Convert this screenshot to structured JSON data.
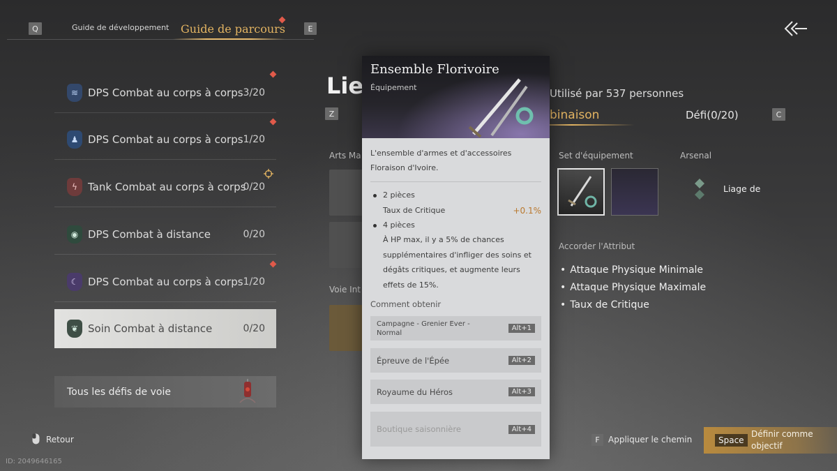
{
  "top_nav": {
    "key_left": "Q",
    "tab_dev": "Guide de développement",
    "tab_parcours": "Guide de parcours",
    "key_right": "E"
  },
  "paths": [
    {
      "name": "DPS Combat au corps à corps",
      "count": "3/20",
      "icon": "wave-icon",
      "alert": true
    },
    {
      "name": "DPS Combat au corps à corps",
      "count": "1/20",
      "icon": "figure-icon",
      "alert": true
    },
    {
      "name": "Tank Combat au corps à corps",
      "count": "0/20",
      "icon": "lightning-icon",
      "alert": false,
      "target": true
    },
    {
      "name": "DPS Combat à distance",
      "count": "0/20",
      "icon": "eye-icon",
      "alert": false
    },
    {
      "name": "DPS Combat au corps à corps",
      "count": "1/20",
      "icon": "crescent-icon",
      "alert": true
    },
    {
      "name": "Soin Combat à distance",
      "count": "0/20",
      "icon": "leaf-icon",
      "alert": false,
      "selected": true
    }
  ],
  "all_challenges": "Tous les défis de voie",
  "main": {
    "title": "Lien",
    "used_by": "Utilisé par 537 personnes",
    "key_z": "Z",
    "tab_combinaison": "binaison",
    "tab_defi": "Défi(0/20)",
    "key_c": "C",
    "arts_label": "Arts Ma",
    "voie_label": "Voie Int",
    "set_label": "Set d'équipement",
    "arsenal_label": "Arsenal",
    "arsenal_item": "Liage de",
    "attr_label": "Accorder l'Attribut",
    "attributes": [
      "Attaque Physique Minimale",
      "Attaque Physique Maximale",
      "Taux de Critique"
    ]
  },
  "popup": {
    "title": "Ensemble Florivoire",
    "subtitle": "Équipement",
    "description": "L'ensemble d'armes et d'accessoires Floraison d'Ivoire.",
    "bonus2_title": "2 pièces",
    "bonus2_stat": "Taux de Critique",
    "bonus2_value": "+0.1%",
    "bonus4_title": "4 pièces",
    "bonus4_text": "À HP max, il y a 5% de chances supplémentaires d'infliger des soins et dégâts critiques, et augmente leurs effets de 15%.",
    "obtain_label": "Comment obtenir",
    "sources": [
      {
        "name": "Campagne - Grenier Ever -Normal",
        "key": "Alt+1"
      },
      {
        "name": "Épreuve de l'Épée",
        "key": "Alt+2"
      },
      {
        "name": "Royaume du Héros",
        "key": "Alt+3"
      },
      {
        "name": "Boutique saisonnière",
        "key": "Alt+4"
      }
    ]
  },
  "footer": {
    "retour": "Retour",
    "id": "ID: 2049646165",
    "key_f": "F",
    "appliquer": "Appliquer le chemin",
    "key_space": "Space",
    "definir": "Définir comme objectif"
  },
  "colors": {
    "accent_gold": "#e3b462",
    "alert_red": "#e05a4a"
  }
}
